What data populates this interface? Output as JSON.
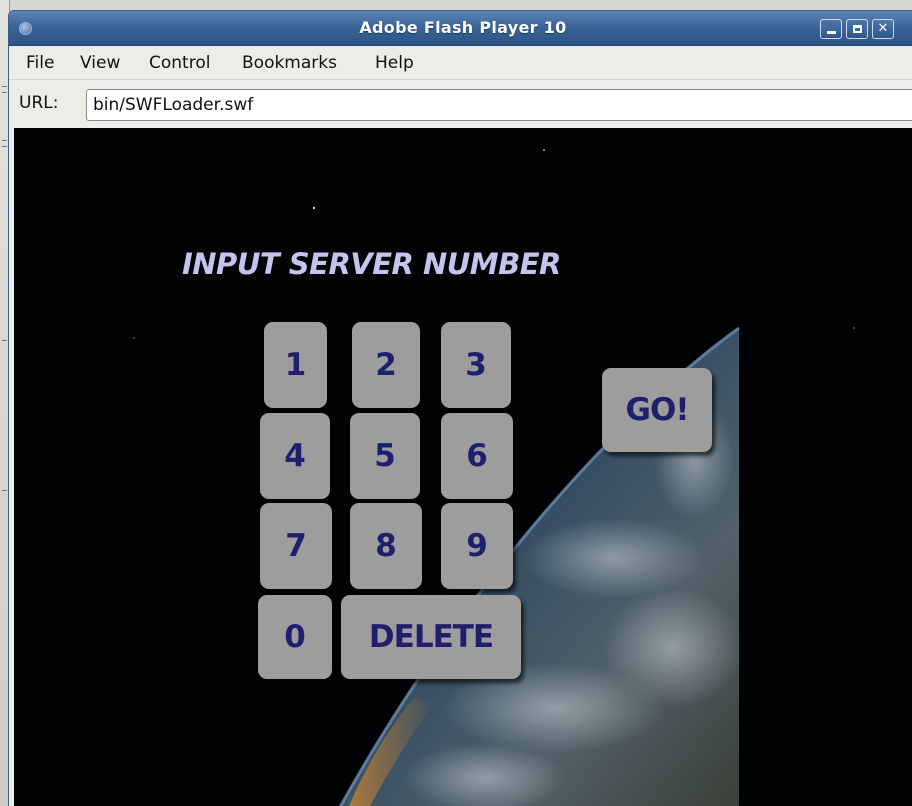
{
  "window": {
    "title": "Adobe Flash Player 10"
  },
  "menubar": {
    "items": [
      "File",
      "View",
      "Control",
      "Bookmarks",
      "Help"
    ]
  },
  "urlbar": {
    "label": "URL:",
    "value": "bin/SWFLoader.swf"
  },
  "app": {
    "heading": "INPUT SERVER NUMBER",
    "keys": [
      "1",
      "2",
      "3",
      "4",
      "5",
      "6",
      "7",
      "8",
      "9",
      "0"
    ],
    "delete_label": "DELETE",
    "go_label": "GO!"
  },
  "colors": {
    "titlebar": "#3b6497",
    "key_face": "#9d9d9d",
    "key_text": "#1f1f6e",
    "heading_text": "#c7c3ef",
    "stage_bg": "#020305"
  }
}
